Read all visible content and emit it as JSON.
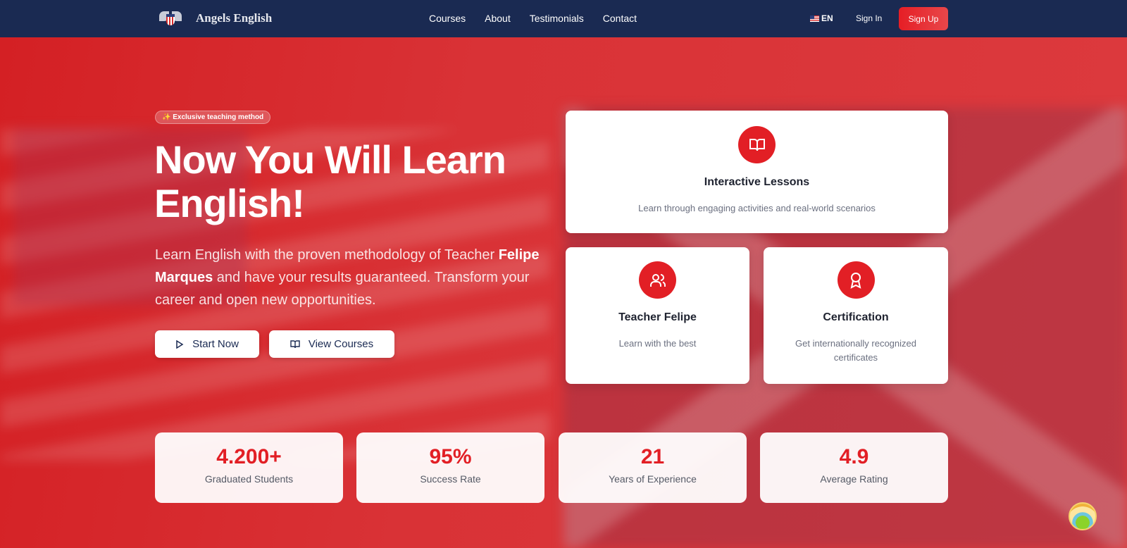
{
  "nav": {
    "brand": "Angels English",
    "links": [
      "Courses",
      "About",
      "Testimonials",
      "Contact"
    ],
    "lang": "EN",
    "sign_in": "Sign In",
    "sign_up": "Sign Up"
  },
  "hero": {
    "badge": "✨ Exclusive teaching method",
    "title": "Now You Will Learn English!",
    "sub_1": "Learn English with the proven methodology of Teacher ",
    "sub_name": "Felipe Marques",
    "sub_2": " and have your results guaranteed. Transform your career and open new opportunities.",
    "start": "Start Now",
    "view": "View Courses"
  },
  "features": [
    {
      "title": "Interactive Lessons",
      "desc": "Learn through engaging activities and real-world scenarios",
      "icon": "book-open-icon"
    },
    {
      "title": "Teacher Felipe",
      "desc": "Learn with the best",
      "icon": "users-icon"
    },
    {
      "title": "Certification",
      "desc": "Get internationally recognized certificates",
      "icon": "award-icon"
    }
  ],
  "stats": [
    {
      "value": "4.200+",
      "label": "Graduated Students"
    },
    {
      "value": "95%",
      "label": "Success Rate"
    },
    {
      "value": "21",
      "label": "Years of Experience"
    },
    {
      "value": "4.9",
      "label": "Average Rating"
    }
  ]
}
